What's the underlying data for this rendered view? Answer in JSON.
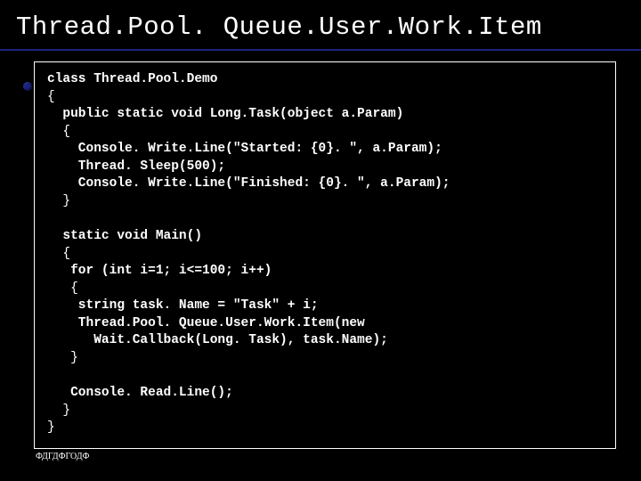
{
  "title": "Thread.Pool. Queue.User.Work.Item",
  "code_lines": [
    "class Thread.Pool.Demo",
    "{",
    "  public static void Long.Task(object a.Param)",
    "  {",
    "    Console. Write.Line(\"Started: {0}. \", a.Param);",
    "    Thread. Sleep(500);",
    "    Console. Write.Line(\"Finished: {0}. \", a.Param);",
    "  }",
    "",
    "  static void Main()",
    "  {",
    "   for (int i=1; i<=100; i++)",
    "   {",
    "    string task. Name = \"Task\" + i;",
    "    Thread.Pool. Queue.User.Work.Item(new",
    "      Wait.Callback(Long. Task), task.Name);",
    "   }",
    "",
    "   Console. Read.Line();",
    "  }",
    "}"
  ],
  "footer": "ФДГДФГОДФ"
}
